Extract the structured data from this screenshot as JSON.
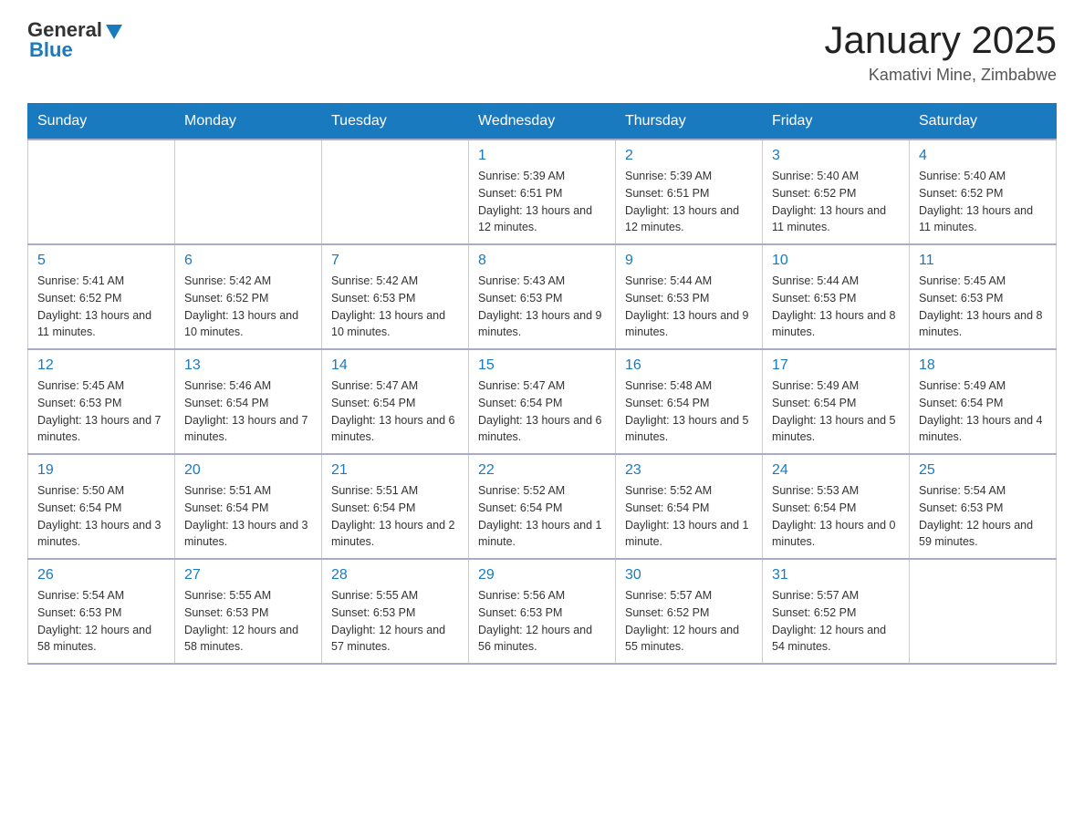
{
  "header": {
    "logo_general": "General",
    "logo_blue": "Blue",
    "title": "January 2025",
    "subtitle": "Kamativi Mine, Zimbabwe"
  },
  "columns": [
    "Sunday",
    "Monday",
    "Tuesday",
    "Wednesday",
    "Thursday",
    "Friday",
    "Saturday"
  ],
  "weeks": [
    [
      {
        "day": "",
        "info": ""
      },
      {
        "day": "",
        "info": ""
      },
      {
        "day": "",
        "info": ""
      },
      {
        "day": "1",
        "info": "Sunrise: 5:39 AM\nSunset: 6:51 PM\nDaylight: 13 hours\nand 12 minutes."
      },
      {
        "day": "2",
        "info": "Sunrise: 5:39 AM\nSunset: 6:51 PM\nDaylight: 13 hours\nand 12 minutes."
      },
      {
        "day": "3",
        "info": "Sunrise: 5:40 AM\nSunset: 6:52 PM\nDaylight: 13 hours\nand 11 minutes."
      },
      {
        "day": "4",
        "info": "Sunrise: 5:40 AM\nSunset: 6:52 PM\nDaylight: 13 hours\nand 11 minutes."
      }
    ],
    [
      {
        "day": "5",
        "info": "Sunrise: 5:41 AM\nSunset: 6:52 PM\nDaylight: 13 hours\nand 11 minutes."
      },
      {
        "day": "6",
        "info": "Sunrise: 5:42 AM\nSunset: 6:52 PM\nDaylight: 13 hours\nand 10 minutes."
      },
      {
        "day": "7",
        "info": "Sunrise: 5:42 AM\nSunset: 6:53 PM\nDaylight: 13 hours\nand 10 minutes."
      },
      {
        "day": "8",
        "info": "Sunrise: 5:43 AM\nSunset: 6:53 PM\nDaylight: 13 hours\nand 9 minutes."
      },
      {
        "day": "9",
        "info": "Sunrise: 5:44 AM\nSunset: 6:53 PM\nDaylight: 13 hours\nand 9 minutes."
      },
      {
        "day": "10",
        "info": "Sunrise: 5:44 AM\nSunset: 6:53 PM\nDaylight: 13 hours\nand 8 minutes."
      },
      {
        "day": "11",
        "info": "Sunrise: 5:45 AM\nSunset: 6:53 PM\nDaylight: 13 hours\nand 8 minutes."
      }
    ],
    [
      {
        "day": "12",
        "info": "Sunrise: 5:45 AM\nSunset: 6:53 PM\nDaylight: 13 hours\nand 7 minutes."
      },
      {
        "day": "13",
        "info": "Sunrise: 5:46 AM\nSunset: 6:54 PM\nDaylight: 13 hours\nand 7 minutes."
      },
      {
        "day": "14",
        "info": "Sunrise: 5:47 AM\nSunset: 6:54 PM\nDaylight: 13 hours\nand 6 minutes."
      },
      {
        "day": "15",
        "info": "Sunrise: 5:47 AM\nSunset: 6:54 PM\nDaylight: 13 hours\nand 6 minutes."
      },
      {
        "day": "16",
        "info": "Sunrise: 5:48 AM\nSunset: 6:54 PM\nDaylight: 13 hours\nand 5 minutes."
      },
      {
        "day": "17",
        "info": "Sunrise: 5:49 AM\nSunset: 6:54 PM\nDaylight: 13 hours\nand 5 minutes."
      },
      {
        "day": "18",
        "info": "Sunrise: 5:49 AM\nSunset: 6:54 PM\nDaylight: 13 hours\nand 4 minutes."
      }
    ],
    [
      {
        "day": "19",
        "info": "Sunrise: 5:50 AM\nSunset: 6:54 PM\nDaylight: 13 hours\nand 3 minutes."
      },
      {
        "day": "20",
        "info": "Sunrise: 5:51 AM\nSunset: 6:54 PM\nDaylight: 13 hours\nand 3 minutes."
      },
      {
        "day": "21",
        "info": "Sunrise: 5:51 AM\nSunset: 6:54 PM\nDaylight: 13 hours\nand 2 minutes."
      },
      {
        "day": "22",
        "info": "Sunrise: 5:52 AM\nSunset: 6:54 PM\nDaylight: 13 hours\nand 1 minute."
      },
      {
        "day": "23",
        "info": "Sunrise: 5:52 AM\nSunset: 6:54 PM\nDaylight: 13 hours\nand 1 minute."
      },
      {
        "day": "24",
        "info": "Sunrise: 5:53 AM\nSunset: 6:54 PM\nDaylight: 13 hours\nand 0 minutes."
      },
      {
        "day": "25",
        "info": "Sunrise: 5:54 AM\nSunset: 6:53 PM\nDaylight: 12 hours\nand 59 minutes."
      }
    ],
    [
      {
        "day": "26",
        "info": "Sunrise: 5:54 AM\nSunset: 6:53 PM\nDaylight: 12 hours\nand 58 minutes."
      },
      {
        "day": "27",
        "info": "Sunrise: 5:55 AM\nSunset: 6:53 PM\nDaylight: 12 hours\nand 58 minutes."
      },
      {
        "day": "28",
        "info": "Sunrise: 5:55 AM\nSunset: 6:53 PM\nDaylight: 12 hours\nand 57 minutes."
      },
      {
        "day": "29",
        "info": "Sunrise: 5:56 AM\nSunset: 6:53 PM\nDaylight: 12 hours\nand 56 minutes."
      },
      {
        "day": "30",
        "info": "Sunrise: 5:57 AM\nSunset: 6:52 PM\nDaylight: 12 hours\nand 55 minutes."
      },
      {
        "day": "31",
        "info": "Sunrise: 5:57 AM\nSunset: 6:52 PM\nDaylight: 12 hours\nand 54 minutes."
      },
      {
        "day": "",
        "info": ""
      }
    ]
  ]
}
